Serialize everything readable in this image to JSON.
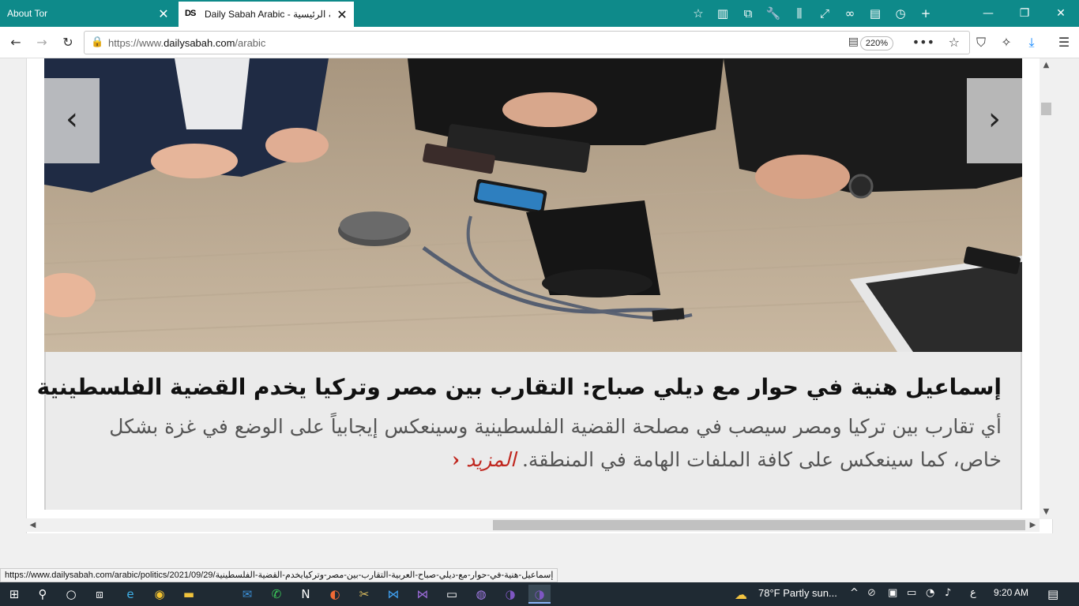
{
  "tabs": [
    {
      "label": "About Tor",
      "active": false
    },
    {
      "label": "Daily Sabah Arabic - الصفحة الرئيسية",
      "favicon": "DS",
      "active": true
    }
  ],
  "toolbar_icons": [
    "bookmark-star-icon",
    "reader-sidebar-icon",
    "sync-tabs-icon",
    "wrench-icon",
    "library-icon",
    "fullscreen-icon",
    "mask-icon",
    "downloads-folder-icon",
    "history-icon",
    "new-tab-plus-icon"
  ],
  "nav": {
    "url_prefix": "https://www.",
    "url_domain": "dailysabah.com",
    "url_path": "/arabic",
    "zoom": "220%"
  },
  "article": {
    "headline": "إسماعيل هنية في حوار مع ديلي صباح: التقارب بين مصر وتركيا  يخدم القضية الفلسطينية",
    "summary": "أي تقارب بين تركيا ومصر سيصب في مصلحة القضية الفلسطينية وسينعكس إيجابياً على الوضع في غزة بشكل خاص، كما سينعكس على كافة الملفات الهامة في المنطقة.",
    "more": "المزيد"
  },
  "status_url": "https://www.dailysabah.com/arabic/politics/2021/09/29/إسماعيل-هنية-في-حوار-مع-ديلي-صباح-العربية-التقارب-بين-مصر-وتركيايخدم-القضية-الفلسطينية",
  "taskbar": {
    "weather": "78°F  Partly sun...",
    "time": "9:20 AM",
    "lang": "ع"
  },
  "colors": {
    "tabbar": "#0e8a8a",
    "accent_link": "#c0271f",
    "taskbar": "#1f2a33"
  }
}
